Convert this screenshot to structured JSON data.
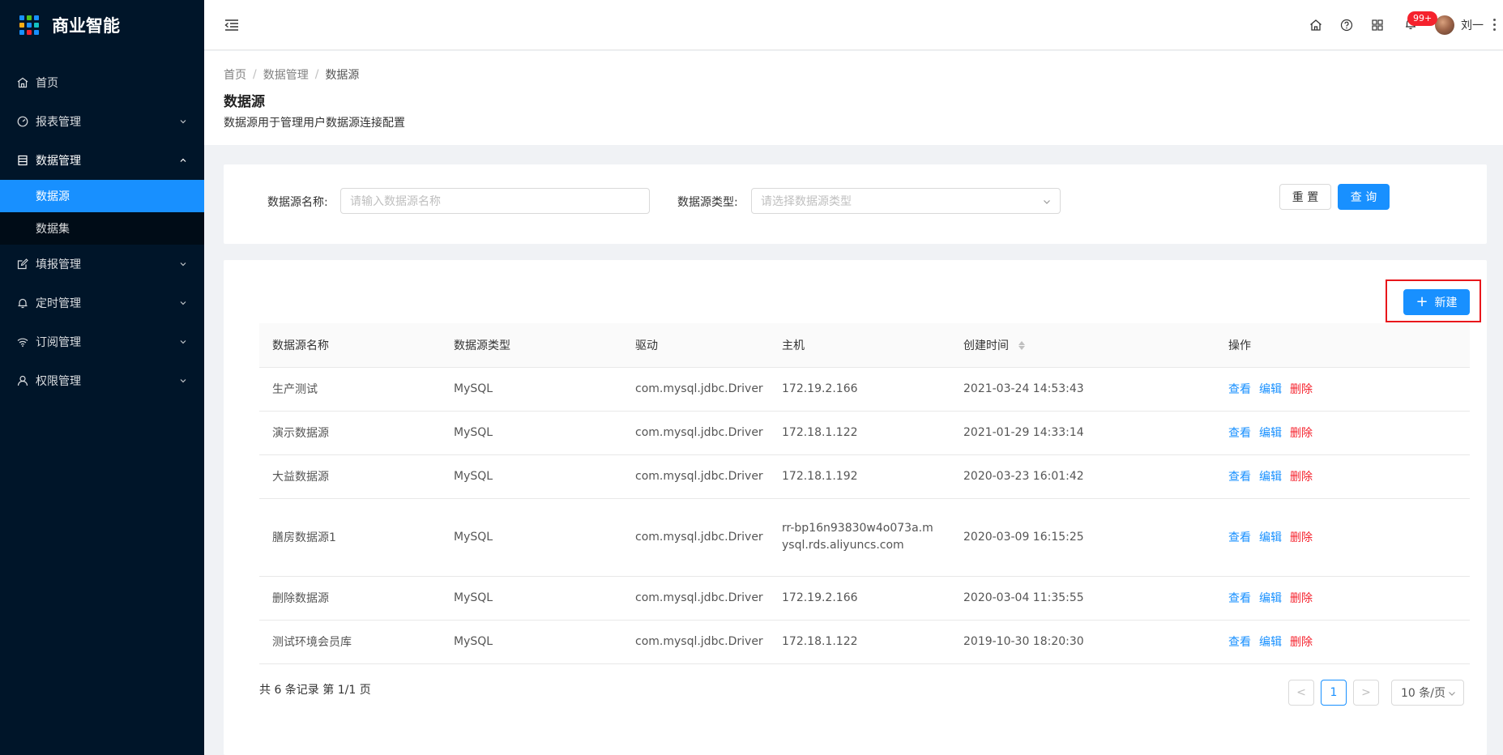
{
  "app": {
    "title": "商业智能"
  },
  "logo_colors": [
    "#1890ff",
    "#52c41a",
    "#1890ff",
    "#faad14",
    "#1890ff",
    "#13c2c2",
    "#1890ff",
    "#f5222d",
    "#1890ff"
  ],
  "sidebar": {
    "items": [
      {
        "label": "首页",
        "icon": "home-icon"
      },
      {
        "label": "报表管理",
        "icon": "dashboard-icon"
      },
      {
        "label": "数据管理",
        "icon": "database-icon",
        "expanded": true,
        "children": [
          {
            "label": "数据源",
            "active": true
          },
          {
            "label": "数据集"
          }
        ]
      },
      {
        "label": "填报管理",
        "icon": "edit-icon"
      },
      {
        "label": "定时管理",
        "icon": "bell-icon"
      },
      {
        "label": "订阅管理",
        "icon": "wifi-icon"
      },
      {
        "label": "权限管理",
        "icon": "user-icon"
      }
    ]
  },
  "header": {
    "badge": "99+",
    "user_name": "刘一"
  },
  "breadcrumb": [
    "首页",
    "数据管理",
    "数据源"
  ],
  "page": {
    "title": "数据源",
    "description": "数据源用于管理用户数据源连接配置"
  },
  "search": {
    "name_label": "数据源名称:",
    "name_placeholder": "请输入数据源名称",
    "type_label": "数据源类型:",
    "type_placeholder": "请选择数据源类型",
    "reset_label": "重 置",
    "query_label": "查 询"
  },
  "toolbar": {
    "new_label": "新建"
  },
  "table": {
    "columns": [
      "数据源名称",
      "数据源类型",
      "驱动",
      "主机",
      "创建时间",
      "操作"
    ],
    "rows": [
      {
        "name": "生产测试",
        "type": "MySQL",
        "driver": "com.mysql.jdbc.Driver",
        "host": "172.19.2.166",
        "created": "2021-03-24 14:53:43"
      },
      {
        "name": "演示数据源",
        "type": "MySQL",
        "driver": "com.mysql.jdbc.Driver",
        "host": "172.18.1.122",
        "created": "2021-01-29 14:33:14"
      },
      {
        "name": "大益数据源",
        "type": "MySQL",
        "driver": "com.mysql.jdbc.Driver",
        "host": "172.18.1.192",
        "created": "2020-03-23 16:01:42"
      },
      {
        "name": "膳房数据源1",
        "type": "MySQL",
        "driver": "com.mysql.jdbc.Driver",
        "host": "rr-bp16n93830w4o073a.mysql.rds.aliyuncs.com",
        "created": "2020-03-09 16:15:25"
      },
      {
        "name": "删除数据源",
        "type": "MySQL",
        "driver": "com.mysql.jdbc.Driver",
        "host": "172.19.2.166",
        "created": "2020-03-04 11:35:55"
      },
      {
        "name": "测试环境会员库",
        "type": "MySQL",
        "driver": "com.mysql.jdbc.Driver",
        "host": "172.18.1.122",
        "created": "2019-10-30 18:20:30"
      }
    ],
    "actions": {
      "view": "查看",
      "edit": "编辑",
      "delete": "删除"
    }
  },
  "pagination": {
    "summary": "共 6 条记录 第 1/1 页",
    "prev": "<",
    "current": "1",
    "next": ">",
    "page_size": "10 条/页"
  }
}
